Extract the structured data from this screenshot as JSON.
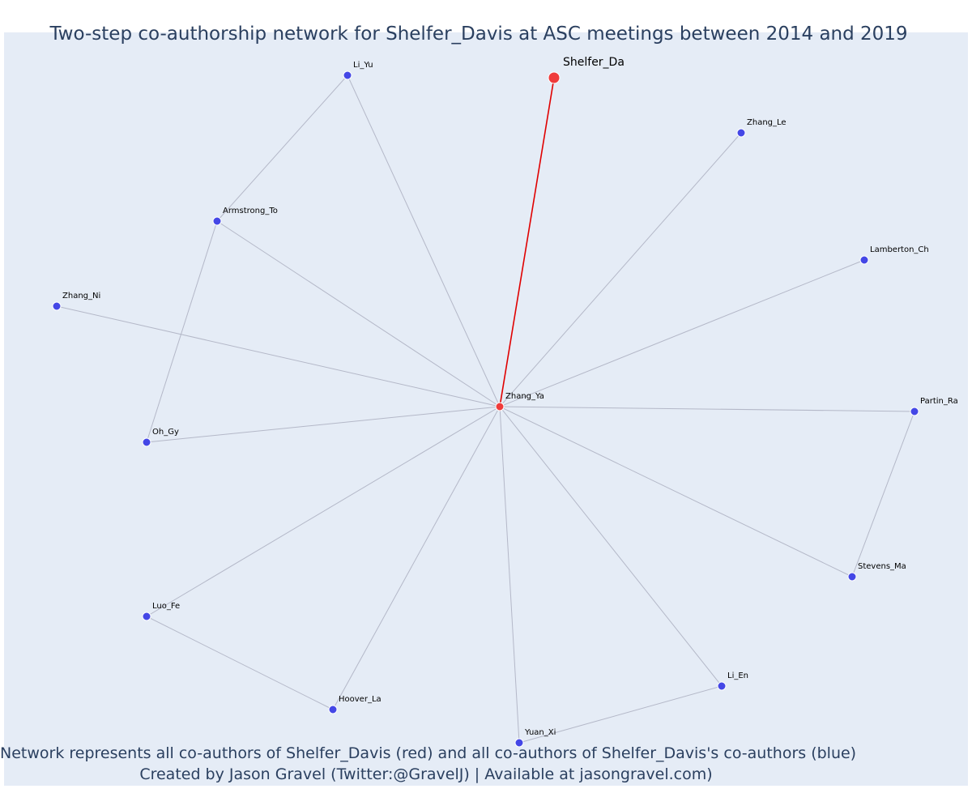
{
  "title": "Two-step co-authorship network for Shelfer_Davis at ASC meetings between 2014 and 2019",
  "caption": {
    "line1": "Network represents all co-authors of Shelfer_Davis (red) and all co-authors of Shelfer_Davis's co-authors (blue)",
    "line2": "Created by Jason Gravel (Twitter:@GravelJ) | Available at jasongravel.com)"
  },
  "colors": {
    "background": "#e5ecf6",
    "ego": "#ef3b3b",
    "first_degree": "#ef3b3b",
    "second_degree": "#4447e6",
    "ego_edge": "#e00000",
    "edge": "#b4b8c8",
    "text": "#2a3f5f"
  },
  "nodes": [
    {
      "id": "Shelfer_Da",
      "label": "Shelfer_Da",
      "role": "ego"
    },
    {
      "id": "Zhang_Ya",
      "label": "Zhang_Ya",
      "role": "coauthor"
    },
    {
      "id": "Li_Yu",
      "label": "Li_Yu",
      "role": "second"
    },
    {
      "id": "Zhang_Le",
      "label": "Zhang_Le",
      "role": "second"
    },
    {
      "id": "Armstrong_To",
      "label": "Armstrong_To",
      "role": "second"
    },
    {
      "id": "Lamberton_Ch",
      "label": "Lamberton_Ch",
      "role": "second"
    },
    {
      "id": "Zhang_Ni",
      "label": "Zhang_Ni",
      "role": "second"
    },
    {
      "id": "Partin_Ra",
      "label": "Partin_Ra",
      "role": "second"
    },
    {
      "id": "Oh_Gy",
      "label": "Oh_Gy",
      "role": "second"
    },
    {
      "id": "Stevens_Ma",
      "label": "Stevens_Ma",
      "role": "second"
    },
    {
      "id": "Luo_Fe",
      "label": "Luo_Fe",
      "role": "second"
    },
    {
      "id": "Li_En",
      "label": "Li_En",
      "role": "second"
    },
    {
      "id": "Hoover_La",
      "label": "Hoover_La",
      "role": "second"
    },
    {
      "id": "Yuan_Xi",
      "label": "Yuan_Xi",
      "role": "second"
    }
  ],
  "edges": [
    {
      "source": "Shelfer_Da",
      "target": "Zhang_Ya",
      "type": "ego"
    },
    {
      "source": "Zhang_Ya",
      "target": "Li_Yu",
      "type": "normal"
    },
    {
      "source": "Zhang_Ya",
      "target": "Zhang_Le",
      "type": "normal"
    },
    {
      "source": "Zhang_Ya",
      "target": "Armstrong_To",
      "type": "normal"
    },
    {
      "source": "Zhang_Ya",
      "target": "Lamberton_Ch",
      "type": "normal"
    },
    {
      "source": "Zhang_Ya",
      "target": "Zhang_Ni",
      "type": "normal"
    },
    {
      "source": "Zhang_Ya",
      "target": "Partin_Ra",
      "type": "normal"
    },
    {
      "source": "Zhang_Ya",
      "target": "Oh_Gy",
      "type": "normal"
    },
    {
      "source": "Zhang_Ya",
      "target": "Stevens_Ma",
      "type": "normal"
    },
    {
      "source": "Zhang_Ya",
      "target": "Luo_Fe",
      "type": "normal"
    },
    {
      "source": "Zhang_Ya",
      "target": "Li_En",
      "type": "normal"
    },
    {
      "source": "Zhang_Ya",
      "target": "Hoover_La",
      "type": "normal"
    },
    {
      "source": "Zhang_Ya",
      "target": "Yuan_Xi",
      "type": "normal"
    },
    {
      "source": "Li_Yu",
      "target": "Armstrong_To",
      "type": "normal"
    },
    {
      "source": "Armstrong_To",
      "target": "Oh_Gy",
      "type": "normal"
    },
    {
      "source": "Partin_Ra",
      "target": "Stevens_Ma",
      "type": "normal"
    },
    {
      "source": "Luo_Fe",
      "target": "Hoover_La",
      "type": "normal"
    },
    {
      "source": "Yuan_Xi",
      "target": "Li_En",
      "type": "normal"
    }
  ]
}
